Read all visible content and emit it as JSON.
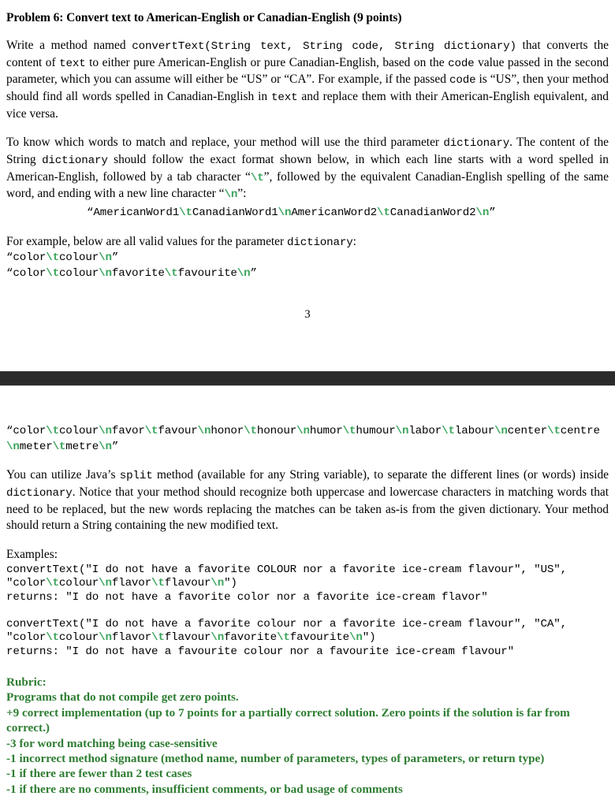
{
  "document": {
    "title": "Problem 6: Convert text to American-English or Canadian-English (9 points)",
    "page_number": "3"
  },
  "colors": {
    "escape_green": "#3BA55C",
    "rubric_green": "#2E7D32",
    "page_separator": "#2B2B2B"
  },
  "page_one": {
    "paragraph_1": {
      "part_1": "Write a method named ",
      "code_1": "convertText(String text, String code, String dictionary)",
      "part_2": " that converts the content of ",
      "code_2": "text",
      "part_3": " to either pure American-English or pure Canadian-English, based on the ",
      "code_3": "code",
      "part_4": " value passed in the second parameter, which you can assume will either be “US” or “CA”. For example, if the passed ",
      "code_4": "code",
      "part_5": " is “US”, then your method should find all words spelled in Canadian-English in ",
      "code_5": "text",
      "part_6": " and replace them with their American-English equivalent, and vice versa."
    },
    "paragraph_2": {
      "part_1": "To know which words to match and replace, your method will use the third parameter ",
      "code_1": "dictionary",
      "part_2": ". The content of the String ",
      "code_2": "dictionary",
      "part_3": " should follow the exact format shown below, in which each line starts with a word spelled in American-English, followed by a tab character “",
      "code_3": "\\t",
      "part_4": "”, followed by the equivalent Canadian-English spelling of the same word, and ending with a new line character “",
      "code_4": "\\n",
      "part_5": "”:"
    },
    "dictionary_format": {
      "open_quote": "“",
      "word_1": "AmericanWord1",
      "esc_1": "\\t",
      "word_2": "CanadianWord1",
      "esc_2": "\\n",
      "word_3": "AmericanWord2",
      "esc_3": "\\t",
      "word_4": "CanadianWord2",
      "esc_4": "\\n",
      "close_quote": "”"
    },
    "paragraph_3": {
      "part_1": "For example, below are all valid values for the parameter ",
      "code_1": "dictionary",
      "part_2": ":"
    },
    "example_dict_1": {
      "open_quote": "“",
      "w1": "color",
      "e1": "\\t",
      "w2": "colour",
      "e2": "\\n",
      "close_quote": "”"
    },
    "example_dict_2": {
      "open_quote": "“",
      "w1": "color",
      "e1": "\\t",
      "w2": "colour",
      "e2": "\\n",
      "w3": "favorite",
      "e3": "\\t",
      "w4": "favourite",
      "e4": "\\n",
      "close_quote": "”"
    }
  },
  "page_two": {
    "long_dictionary": {
      "open_quote": "“",
      "pairs": [
        {
          "american": "color",
          "tab": "\\t",
          "canadian": "colour",
          "newline": "\\n"
        },
        {
          "american": "favor",
          "tab": "\\t",
          "canadian": "favour",
          "newline": "\\n"
        },
        {
          "american": "honor",
          "tab": "\\t",
          "canadian": "honour",
          "newline": "\\n"
        },
        {
          "american": "humor",
          "tab": "\\t",
          "canadian": "humour",
          "newline": "\\n"
        },
        {
          "american": "labor",
          "tab": "\\t",
          "canadian": "labour",
          "newline": "\\n"
        },
        {
          "american": "center",
          "tab": "\\t",
          "canadian": "centre",
          "newline": "\\n"
        },
        {
          "american": "meter",
          "tab": "\\t",
          "canadian": "metre",
          "newline": "\\n"
        }
      ],
      "close_quote": "”"
    },
    "paragraph_split": {
      "part_1": "You can utilize Java’s ",
      "code_1": "split",
      "part_2": " method (available for any String variable), to separate the different lines (or words) inside ",
      "code_2": "dictionary",
      "part_3": ". Notice that your method should recognize both uppercase and lowercase characters in matching words that need to be replaced, but the new words replacing the matches can be taken as-is from the given dictionary. Your method should return a String containing the new modified text."
    },
    "examples_label": "Examples:",
    "example_1": {
      "call_part_1": "convertText(\"I do not have a favorite COLOUR nor a favorite ice-cream flavour\", \"US\", \"color",
      "esc_1": "\\t",
      "call_part_2": "colour",
      "esc_2": "\\n",
      "call_part_3": "flavor",
      "esc_3": "\\t",
      "call_part_4": "flavour",
      "esc_4": "\\n",
      "call_part_5": "\")",
      "returns": "returns: \"I do not have a favorite color nor a favorite ice-cream flavor\""
    },
    "example_2": {
      "call_part_1": "convertText(\"I do not have a favorite colour nor a favorite ice-cream flavour\", \"CA\", \"color",
      "esc_1": "\\t",
      "call_part_2": "colour",
      "esc_2": "\\n",
      "call_part_3": "flavor",
      "esc_3": "\\t",
      "call_part_4": "flavour",
      "esc_4": "\\n",
      "call_part_5": "favorite",
      "esc_5": "\\t",
      "call_part_6": "favourite",
      "esc_6": "\\n",
      "call_part_7": "\")",
      "returns": "returns: \"I do not have a favourite colour nor a favourite ice-cream flavour\""
    },
    "rubric": {
      "heading": "Rubric:",
      "items": [
        "Programs that do not compile get zero points.",
        "+9 correct implementation (up to 7 points for a partially correct solution. Zero points if the solution is far from correct.)",
        "-3 for word matching being case-sensitive",
        "-1 incorrect method signature (method name, number of parameters, types of parameters, or return type)",
        "-1 if there are fewer than 2 test cases",
        "-1 if there are no comments, insufficient comments, or bad usage of comments"
      ]
    }
  }
}
